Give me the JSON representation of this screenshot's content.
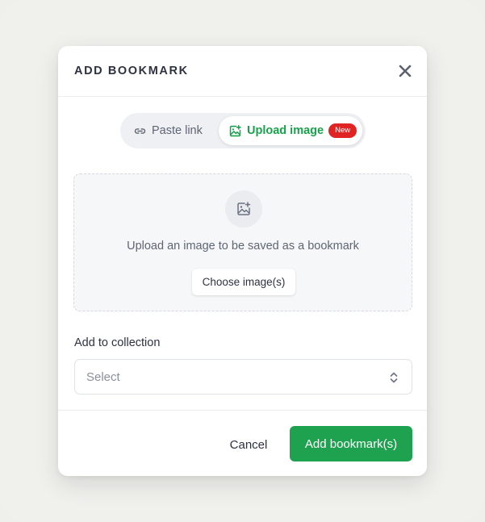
{
  "modal": {
    "title": "ADD BOOKMARK",
    "close_icon": "close-icon"
  },
  "tabs": [
    {
      "label": "Paste link",
      "icon": "link-icon",
      "active": false
    },
    {
      "label": "Upload image",
      "icon": "image-add-icon",
      "active": true,
      "badge": "New"
    }
  ],
  "dropzone": {
    "icon": "image-add-icon",
    "text": "Upload an image to be saved as a bookmark",
    "button_label": "Choose image(s)"
  },
  "collection": {
    "label": "Add to collection",
    "placeholder": "Select",
    "chevron_icon": "chevron-up-down-icon"
  },
  "footer": {
    "cancel_label": "Cancel",
    "submit_label": "Add bookmark(s)"
  },
  "colors": {
    "accent": "#1ea24f",
    "active_tab_text": "#17a34a",
    "badge": "#e02424",
    "background": "#efefec"
  }
}
